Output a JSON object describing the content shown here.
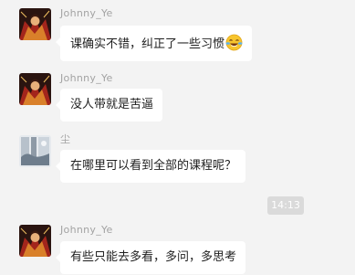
{
  "messages": [
    {
      "sender": "Johnny_Ye",
      "avatar": "superhero-avatar",
      "text": "课确实不错，纠正了一些习惯",
      "emoji": "tears-of-joy-emoji"
    },
    {
      "sender": "Johnny_Ye",
      "avatar": "superhero-avatar",
      "text": "没人带就是苦逼"
    },
    {
      "sender": "尘",
      "avatar": "landscape-avatar",
      "text": "在哪里可以看到全部的课程呢？"
    },
    {
      "sender": "Johnny_Ye",
      "avatar": "superhero-avatar",
      "text": "有些只能去多看，多问，多思考"
    }
  ],
  "timestamp": "14:13",
  "colors": {
    "background": "#f3f3f3",
    "bubble": "#ffffff",
    "sender_text": "#a3a3a3",
    "timestamp_bg": "#dadada"
  }
}
